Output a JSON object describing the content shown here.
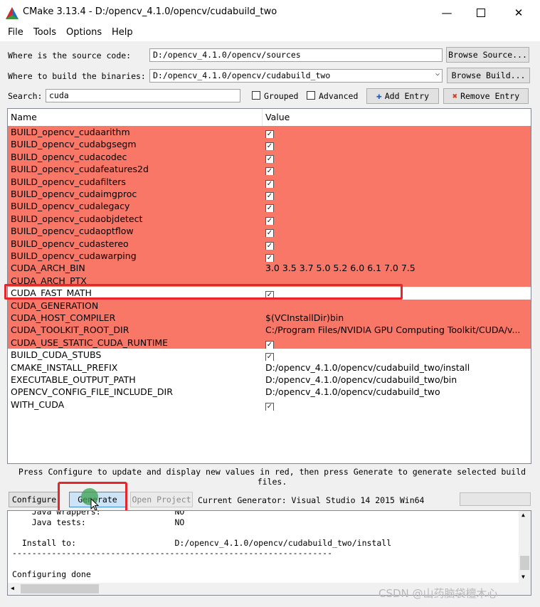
{
  "window": {
    "title": "CMake 3.13.4 - D:/opencv_4.1.0/opencv/cudabuild_two"
  },
  "menu": [
    "File",
    "Tools",
    "Options",
    "Help"
  ],
  "source": {
    "label": "Where is the source code:",
    "value": "D:/opencv_4.1.0/opencv/sources",
    "browse": "Browse Source..."
  },
  "build": {
    "label": "Where to build the binaries:",
    "value": "D:/opencv_4.1.0/opencv/cudabuild_two",
    "browse": "Browse Build..."
  },
  "search": {
    "label": "Search:",
    "value": "cuda",
    "grouped": "Grouped",
    "advanced": "Advanced",
    "add_entry": "Add Entry",
    "remove_entry": "Remove Entry"
  },
  "table": {
    "columns": [
      "Name",
      "Value"
    ],
    "rows": [
      {
        "name": "BUILD_opencv_cudaarithm",
        "value": "",
        "check": true,
        "state": "new"
      },
      {
        "name": "BUILD_opencv_cudabgsegm",
        "value": "",
        "check": true,
        "state": "new"
      },
      {
        "name": "BUILD_opencv_cudacodec",
        "value": "",
        "check": true,
        "state": "new"
      },
      {
        "name": "BUILD_opencv_cudafeatures2d",
        "value": "",
        "check": true,
        "state": "new"
      },
      {
        "name": "BUILD_opencv_cudafilters",
        "value": "",
        "check": true,
        "state": "new"
      },
      {
        "name": "BUILD_opencv_cudaimgproc",
        "value": "",
        "check": true,
        "state": "new"
      },
      {
        "name": "BUILD_opencv_cudalegacy",
        "value": "",
        "check": true,
        "state": "new"
      },
      {
        "name": "BUILD_opencv_cudaobjdetect",
        "value": "",
        "check": true,
        "state": "new"
      },
      {
        "name": "BUILD_opencv_cudaoptflow",
        "value": "",
        "check": true,
        "state": "new"
      },
      {
        "name": "BUILD_opencv_cudastereo",
        "value": "",
        "check": true,
        "state": "new"
      },
      {
        "name": "BUILD_opencv_cudawarping",
        "value": "",
        "check": true,
        "state": "new"
      },
      {
        "name": "CUDA_ARCH_BIN",
        "value": "3.0 3.5 3.7 5.0 5.2 6.0 6.1 7.0 7.5",
        "check": false,
        "state": "new"
      },
      {
        "name": "CUDA_ARCH_PTX",
        "value": "",
        "check": false,
        "state": "new"
      },
      {
        "name": "CUDA_FAST_MATH",
        "value": "",
        "check": true,
        "state": "selected"
      },
      {
        "name": "CUDA_GENERATION",
        "value": "",
        "check": false,
        "state": "new"
      },
      {
        "name": "CUDA_HOST_COMPILER",
        "value": "$(VCInstallDir)bin",
        "check": false,
        "state": "new"
      },
      {
        "name": "CUDA_TOOLKIT_ROOT_DIR",
        "value": "C:/Program Files/NVIDIA GPU Computing Toolkit/CUDA/v...",
        "check": false,
        "state": "new"
      },
      {
        "name": "CUDA_USE_STATIC_CUDA_RUNTIME",
        "value": "",
        "check": true,
        "state": "new"
      },
      {
        "name": "BUILD_CUDA_STUBS",
        "value": "",
        "check": true,
        "state": "normal"
      },
      {
        "name": "CMAKE_INSTALL_PREFIX",
        "value": "D:/opencv_4.1.0/opencv/cudabuild_two/install",
        "check": false,
        "state": "normal"
      },
      {
        "name": "EXECUTABLE_OUTPUT_PATH",
        "value": "D:/opencv_4.1.0/opencv/cudabuild_two/bin",
        "check": false,
        "state": "normal"
      },
      {
        "name": "OPENCV_CONFIG_FILE_INCLUDE_DIR",
        "value": "D:/opencv_4.1.0/opencv/cudabuild_two",
        "check": false,
        "state": "normal"
      },
      {
        "name": "WITH_CUDA",
        "value": "",
        "check": true,
        "state": "normal"
      }
    ]
  },
  "hint": "Press Configure to update and display new values in red, then press Generate to generate selected build files.",
  "actions": {
    "configure": "Configure",
    "generate": "Generate",
    "open_project": "Open Project",
    "generator": "Current Generator: Visual Studio 14 2015 Win64"
  },
  "output": [
    "    Java wrappers:               NO",
    "    Java tests:                  NO",
    "",
    "  Install to:                    D:/opencv_4.1.0/opencv/cudabuild_two/install",
    "-----------------------------------------------------------------",
    "",
    "Configuring done"
  ],
  "watermark": "CSDN @山药脑袋檀木心"
}
